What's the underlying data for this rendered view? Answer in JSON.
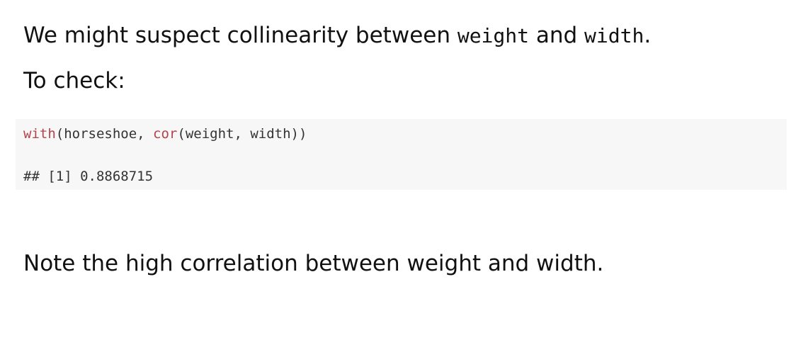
{
  "paragraph1": {
    "text_a": "We might suspect collinearity between ",
    "code_a": "weight",
    "text_b": " and ",
    "code_b": "width",
    "text_c": "."
  },
  "paragraph2": {
    "text": "To check:"
  },
  "code_block": {
    "line1": {
      "fn1": "with",
      "seg1": "(horseshoe, ",
      "fn2": "cor",
      "seg2": "(weight, width))"
    },
    "output": "## [1] 0.8868715"
  },
  "paragraph3": {
    "text": "Note the high correlation between weight and width."
  },
  "colors": {
    "function_name": "#b5424a",
    "code_background": "#f7f7f7",
    "text": "#111111"
  }
}
